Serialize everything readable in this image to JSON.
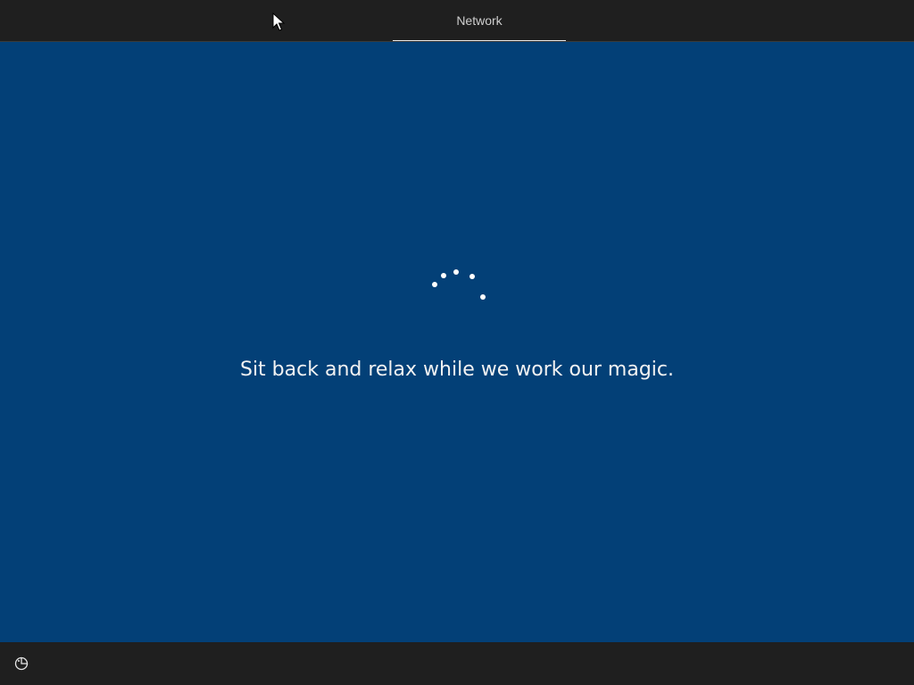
{
  "header": {
    "tabs": [
      {
        "label": "Network",
        "active": true
      }
    ]
  },
  "main": {
    "message": "Sit back and relax while we work our magic.",
    "background_color": "#034077",
    "spinner": {
      "state": "loading",
      "icon": "loading-spinner-dots"
    }
  },
  "footer": {
    "ease_of_access_icon": "ease-of-access-icon"
  },
  "colors": {
    "bar_background": "#1f1f1f",
    "accent": "#034077",
    "text": "#f2f2f2"
  }
}
